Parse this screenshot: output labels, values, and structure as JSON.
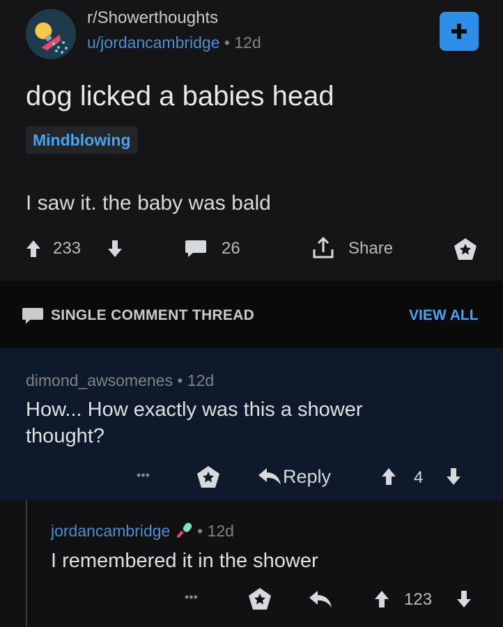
{
  "post": {
    "subreddit": "r/Showerthoughts",
    "author": "u/jordancambridge",
    "separator": "•",
    "age": "12d",
    "title": "dog licked a babies head",
    "flair": "Mindblowing",
    "body": "I saw it. the baby was bald",
    "upvotes": "233",
    "comments": "26",
    "share_label": "Share",
    "join_icon": "plus-icon"
  },
  "thread_bar": {
    "title": "SINGLE COMMENT THREAD",
    "view_all": "VIEW ALL"
  },
  "comment": {
    "author": "dimond_awsomenes",
    "separator": "•",
    "age": "12d",
    "body_line1": "How... How exactly was this a shower",
    "body_line2": "thought?",
    "more": "•••",
    "reply_label": "Reply",
    "votes": "4"
  },
  "reply": {
    "author": "jordancambridge",
    "separator": "•",
    "age": "12d",
    "body": "I remembered it in the shower",
    "more": "•••",
    "votes": "123"
  },
  "colors": {
    "accent": "#2f8fe8",
    "link": "#4a8fd3",
    "highlight_bg": "#0e1a2b",
    "background": "#121214"
  }
}
